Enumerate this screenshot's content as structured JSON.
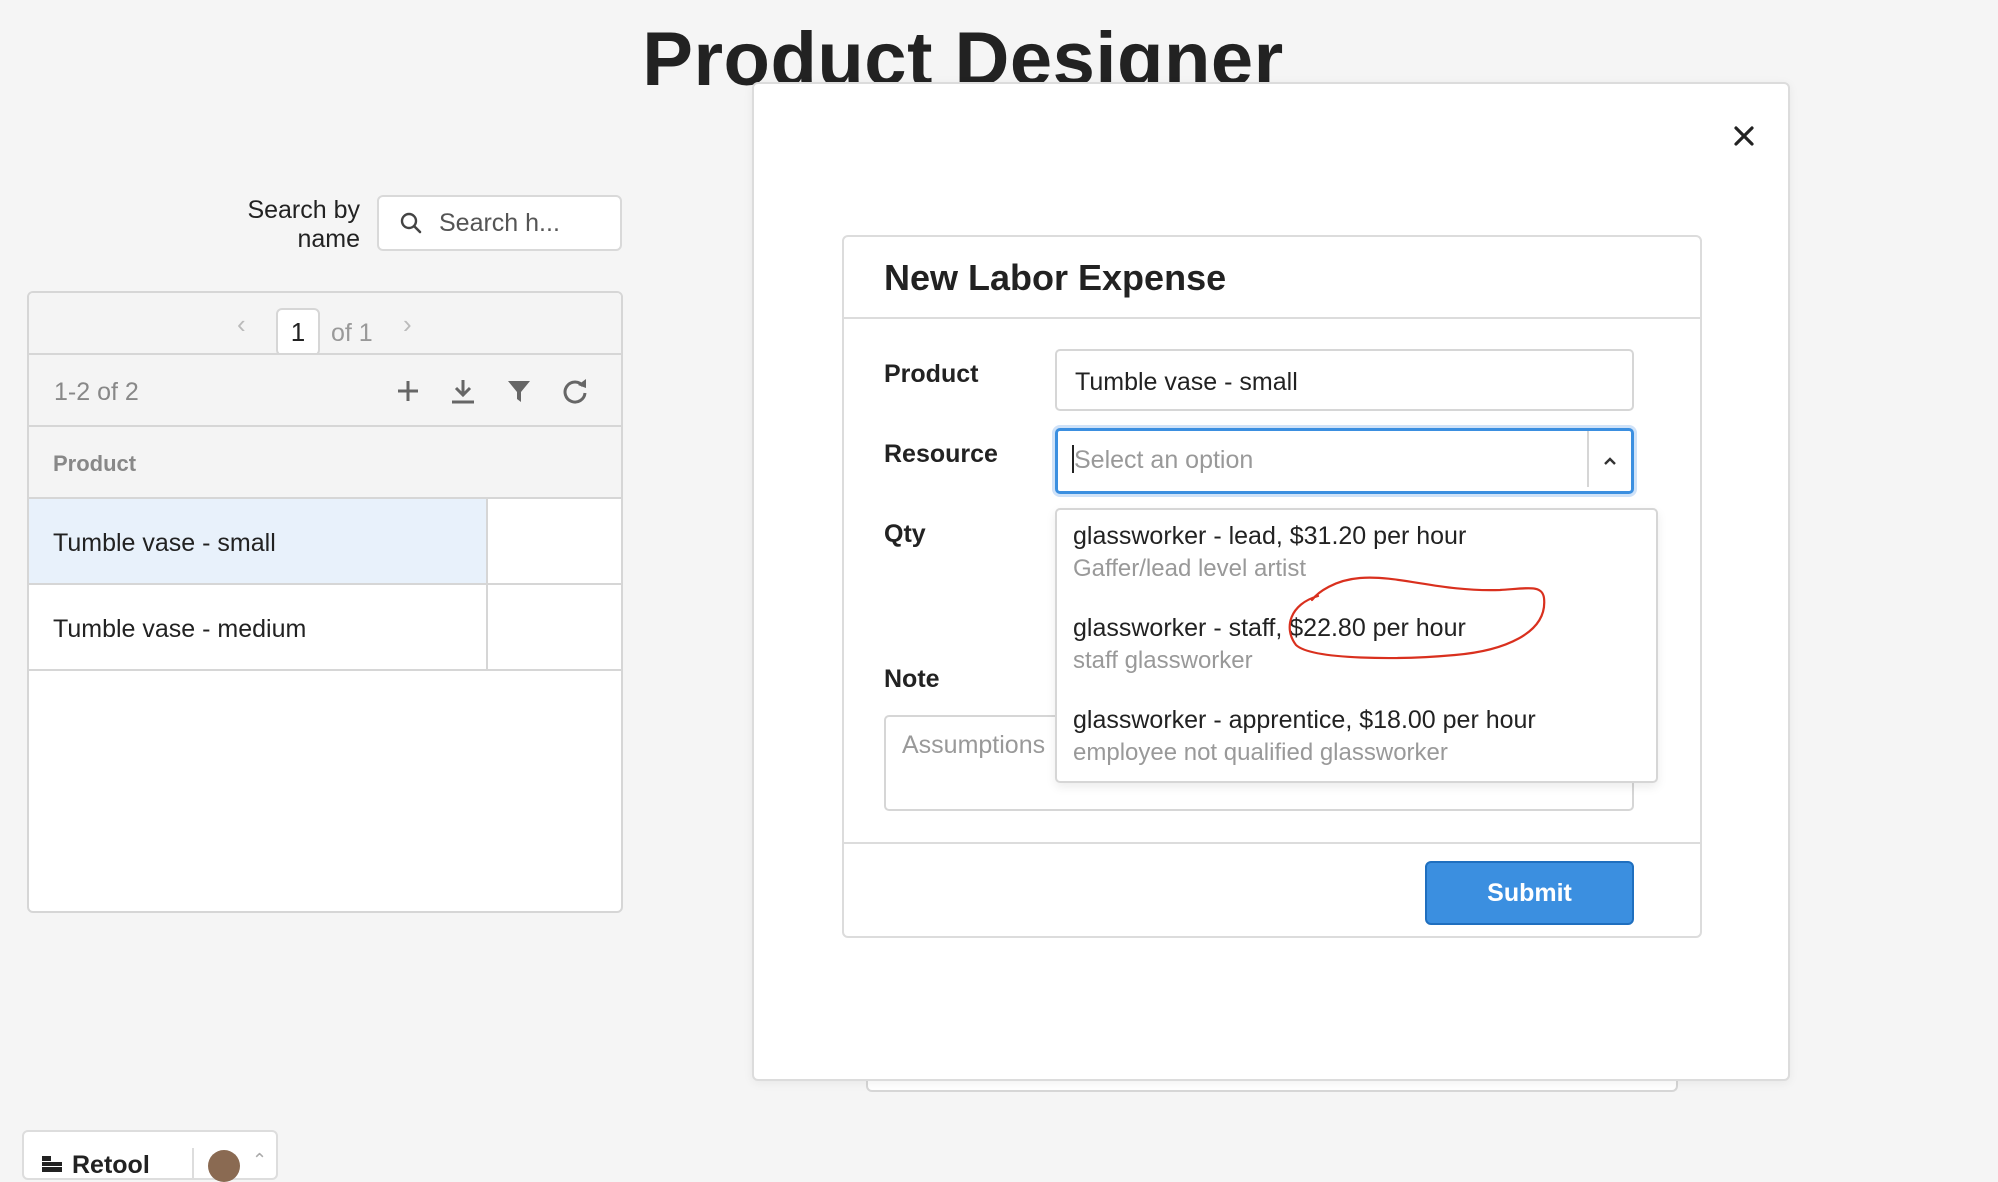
{
  "page": {
    "title": "Product Designer"
  },
  "search": {
    "label": "Search by name",
    "placeholder": "Search h..."
  },
  "table": {
    "pager": {
      "page": "1",
      "of": "of 1",
      "prev": "‹",
      "next": "›"
    },
    "count": "1-2 of 2",
    "columns": [
      "Product"
    ],
    "rows": [
      {
        "product": "Tumble vase - small",
        "selected": true
      },
      {
        "product": "Tumble vase - medium",
        "selected": false
      }
    ],
    "toolbar_icons": [
      "add-icon",
      "download-icon",
      "filter-icon",
      "refresh-icon"
    ]
  },
  "footer": {
    "brand": "Retool"
  },
  "modal": {
    "close_icon": "close-icon",
    "form": {
      "title": "New Labor Expense",
      "product": {
        "label": "Product",
        "value": "Tumble vase - small"
      },
      "resource": {
        "label": "Resource",
        "placeholder": "Select an option",
        "options": [
          {
            "main": "glassworker - lead, $31.20 per hour",
            "sub": "Gaffer/lead level artist"
          },
          {
            "main": "glassworker - staff, $22.80 per hour",
            "sub": "staff glassworker"
          },
          {
            "main": "glassworker - apprentice, $18.00 per hour",
            "sub": "employee not qualified glassworker"
          }
        ]
      },
      "qty": {
        "label": "Qty"
      },
      "note": {
        "label": "Note",
        "placeholder": "Assumptions"
      },
      "submit_label": "Submit"
    }
  },
  "colors": {
    "accent": "#3b8fe0",
    "selected_row": "#e8f1fb",
    "annotation": "#d9301e"
  }
}
